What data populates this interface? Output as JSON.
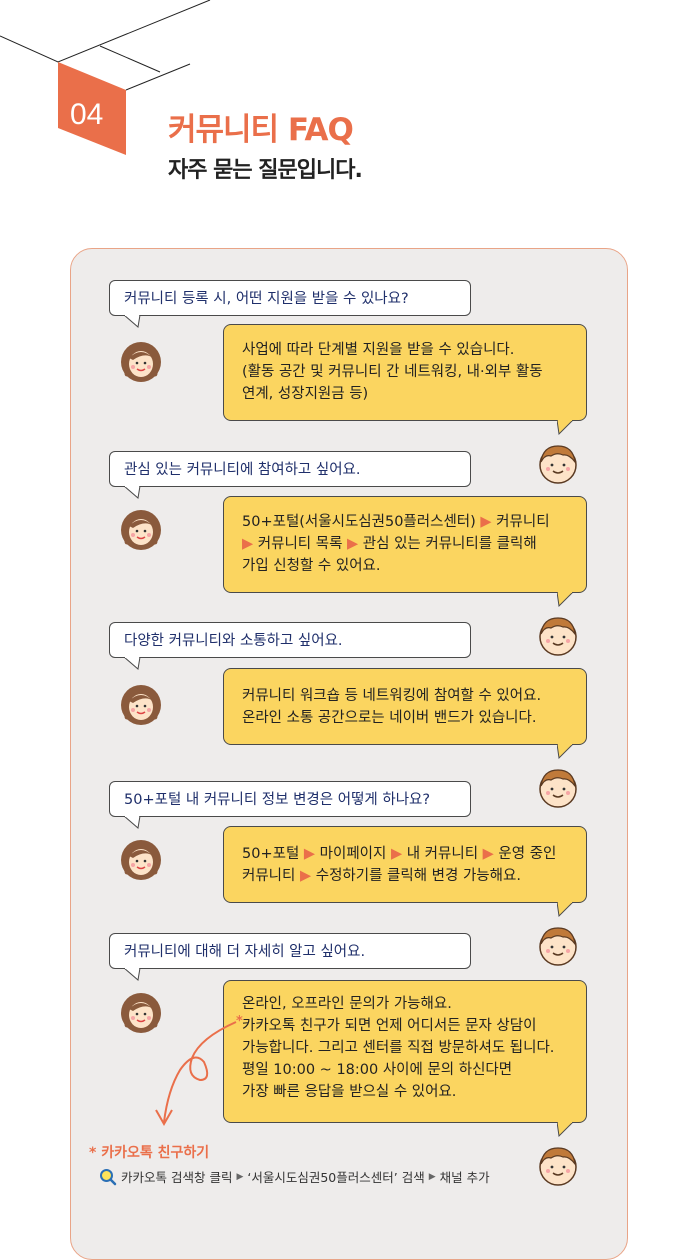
{
  "section": {
    "number": "04",
    "title": "커뮤니티 FAQ",
    "subtitle": "자주 묻는 질문입니다."
  },
  "faq": [
    {
      "question": "커뮤니티 등록 시, 어떤 지원을 받을 수 있나요?",
      "answer": [
        "사업에 따라 단계별 지원을 받을 수 있습니다.",
        "(활동 공간 및 커뮤니티 간 네트워킹, 내·외부 활동",
        " 연계, 성장지원금 등)"
      ]
    },
    {
      "question": "관심 있는 커뮤니티에 참여하고 싶어요.",
      "answer_parts": [
        [
          "50+포털(서울시도심권50플러스센터) ",
          "▶",
          " 커뮤니티"
        ],
        [
          "▶",
          " 커뮤니티 목록 ",
          "▶",
          " 관심 있는 커뮤니티를 클릭해"
        ],
        [
          "가입 신청할 수 있어요."
        ]
      ]
    },
    {
      "question": "다양한 커뮤니티와 소통하고 싶어요.",
      "answer": [
        "커뮤니티 워크숍 등 네트워킹에 참여할 수 있어요.",
        "온라인 소통 공간으로는 네이버 밴드가 있습니다."
      ]
    },
    {
      "question": "50+포털 내 커뮤니티 정보 변경은 어떻게 하나요?",
      "answer_parts": [
        [
          "50+포털 ",
          "▶",
          " 마이페이지 ",
          "▶",
          " 내 커뮤니티 ",
          "▶",
          " 운영 중인"
        ],
        [
          "커뮤니티 ",
          "▶",
          " 수정하기를 클릭해 변경 가능해요."
        ]
      ]
    },
    {
      "question": "커뮤니티에 대해 더 자세히 알고 싶어요.",
      "answer": [
        "온라인, 오프라인 문의가 가능해요.",
        "카카오톡 친구가 되면 언제 어디서든 문자 상담이",
        "가능합니다. 그리고 센터를 직접 방문하셔도 됩니다.",
        "평일 10:00 ~ 18:00 사이에 문의 하신다면",
        "가장 빠른 응답을 받으실 수 있어요."
      ],
      "star": "*"
    }
  ],
  "kakao": {
    "title": "* 카카오톡 친구하기",
    "steps": [
      "카카오톡 검색창 클릭",
      "‘서울시도심권50플러스센터’ 검색",
      "채널 추가"
    ],
    "separator": "▶"
  },
  "colors": {
    "accent": "#ea6f4a",
    "answer_bg": "#fbd560",
    "panel_bg": "#eeeceb",
    "question_text": "#1f2f6b"
  },
  "icons": [
    "woman-avatar-icon",
    "man-avatar-icon",
    "search-icon",
    "curly-arrow-icon"
  ]
}
